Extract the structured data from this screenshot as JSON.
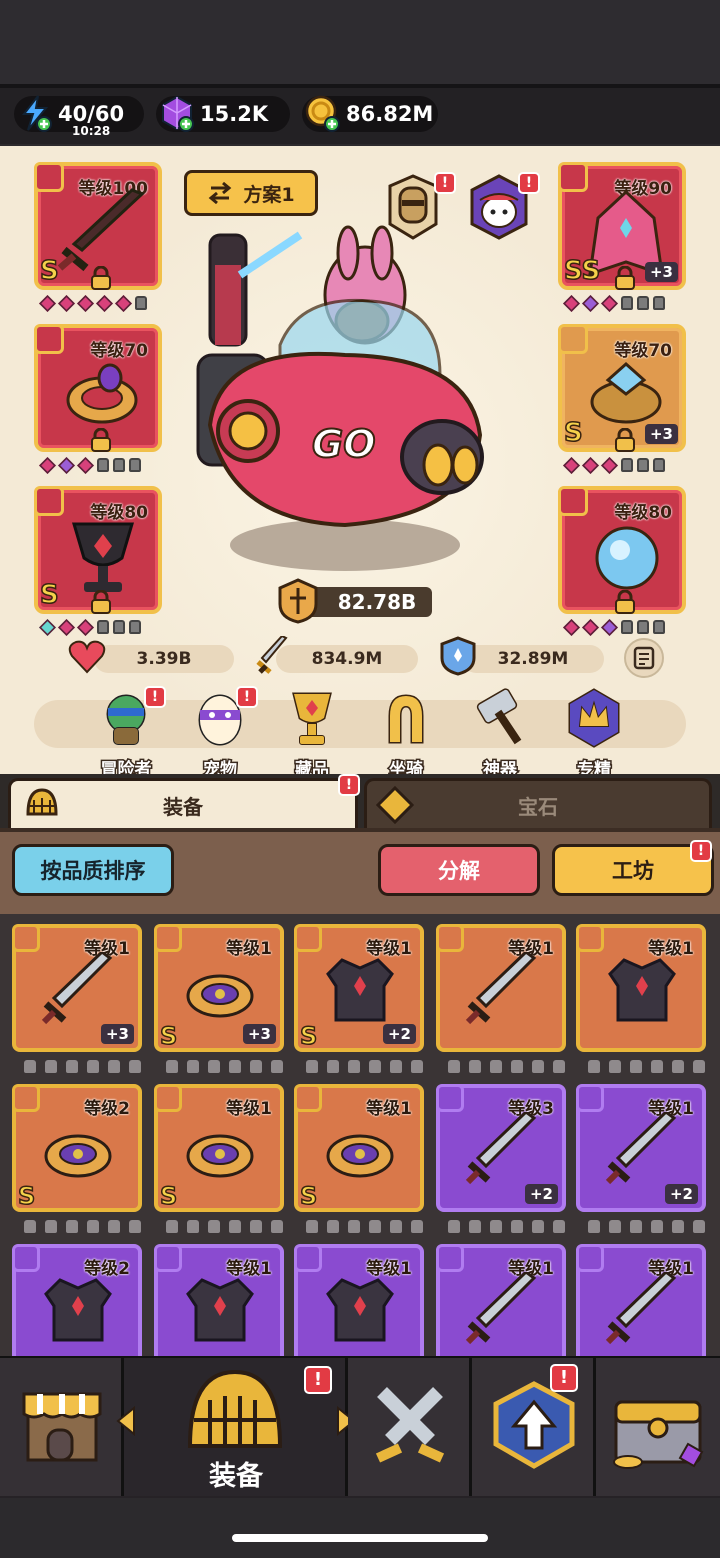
{
  "resources": {
    "energy": "40/60",
    "energy_timer": "10:28",
    "gems": "15.2K",
    "gold": "86.82M"
  },
  "loadout": {
    "label": "方案1"
  },
  "equipped_left": [
    {
      "level": "等级100",
      "grade": "S",
      "type": "weapon"
    },
    {
      "level": "等级70",
      "grade": "",
      "type": "ring"
    },
    {
      "level": "等级80",
      "grade": "S",
      "type": "amulet"
    }
  ],
  "equipped_right": [
    {
      "level": "等级90",
      "grade": "SS",
      "plus": "+3",
      "type": "armor"
    },
    {
      "level": "等级70",
      "grade": "S",
      "plus": "+3",
      "type": "ring"
    },
    {
      "level": "等级80",
      "grade": "",
      "plus": "",
      "type": "amulet"
    }
  ],
  "vehicle_text": "GO",
  "power": "82.78B",
  "stats": {
    "hp": "3.39B",
    "attack": "834.9M",
    "defense": "32.89M"
  },
  "features": [
    {
      "label": "冒险者",
      "alert": true
    },
    {
      "label": "宠物",
      "alert": true
    },
    {
      "label": "藏品",
      "alert": false
    },
    {
      "label": "坐骑",
      "alert": false
    },
    {
      "label": "神器",
      "alert": false
    },
    {
      "label": "专精",
      "alert": false
    }
  ],
  "tabs": {
    "equipment": "装备",
    "gems": "宝石"
  },
  "actions": {
    "sort": "按品质排序",
    "decompose": "分解",
    "workshop": "工坊"
  },
  "inventory": [
    {
      "level": "等级1",
      "grade": "",
      "plus": "+3",
      "rarity": "orange",
      "type": "sword"
    },
    {
      "level": "等级1",
      "grade": "S",
      "plus": "+3",
      "rarity": "orange",
      "type": "ring"
    },
    {
      "level": "等级1",
      "grade": "S",
      "plus": "+2",
      "rarity": "orange",
      "type": "armor"
    },
    {
      "level": "等级1",
      "grade": "",
      "plus": "",
      "rarity": "orange",
      "type": "sword"
    },
    {
      "level": "等级1",
      "grade": "",
      "plus": "",
      "rarity": "orange",
      "type": "armor"
    },
    {
      "level": "等级2",
      "grade": "S",
      "plus": "",
      "rarity": "orange",
      "type": "ring"
    },
    {
      "level": "等级1",
      "grade": "S",
      "plus": "",
      "rarity": "orange",
      "type": "ring"
    },
    {
      "level": "等级1",
      "grade": "S",
      "plus": "",
      "rarity": "orange",
      "type": "ring"
    },
    {
      "level": "等级3",
      "grade": "",
      "plus": "+2",
      "rarity": "purple",
      "type": "sword"
    },
    {
      "level": "等级1",
      "grade": "",
      "plus": "+2",
      "rarity": "purple",
      "type": "sword"
    },
    {
      "level": "等级2",
      "grade": "",
      "plus": "",
      "rarity": "purple",
      "type": "armor"
    },
    {
      "level": "等级1",
      "grade": "",
      "plus": "",
      "rarity": "purple",
      "type": "armor"
    },
    {
      "level": "等级1",
      "grade": "",
      "plus": "",
      "rarity": "purple",
      "type": "armor"
    },
    {
      "level": "等级1",
      "grade": "",
      "plus": "",
      "rarity": "purple",
      "type": "sword"
    },
    {
      "level": "等级1",
      "grade": "",
      "plus": "",
      "rarity": "purple",
      "type": "sword"
    }
  ],
  "bottom_nav": {
    "active_label": "装备"
  },
  "alert_mark": "!"
}
